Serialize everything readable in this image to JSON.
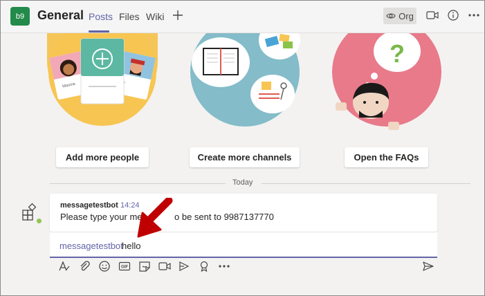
{
  "header": {
    "team_initials": "b9",
    "channel_title": "General",
    "tabs": [
      {
        "label": "Posts",
        "active": true
      },
      {
        "label": "Files",
        "active": false
      },
      {
        "label": "Wiki",
        "active": false
      }
    ],
    "add_tab_label": "+",
    "org_label": "Org",
    "icons": [
      "eye-icon",
      "meet-now-icon",
      "info-icon",
      "more-options-icon"
    ]
  },
  "welcome": {
    "buttons": [
      {
        "label": "Add more people"
      },
      {
        "label": "Create more channels"
      },
      {
        "label": "Open the FAQs"
      }
    ],
    "illustration_names": [
      "Maxine",
      "ay"
    ]
  },
  "divider": {
    "label": "Today"
  },
  "message": {
    "sender": "messagetestbot",
    "time": "14:24",
    "text": "Please type your message to be sent to 9987137770",
    "text_visible_left": "Please type your mes",
    "text_visible_right": "o be sent to 9987137770"
  },
  "compose": {
    "mention": "messagetestbot",
    "text": "hello"
  },
  "toolbar": {
    "icons": [
      "format-icon",
      "attach-icon",
      "emoji-icon",
      "gif-icon",
      "sticker-icon",
      "meet-icon",
      "stream-icon",
      "praise-icon",
      "more-icon"
    ],
    "gif_label": "GIF",
    "send_icon": "send-icon"
  },
  "colors": {
    "brand": "#6264a7",
    "team_avatar": "#228a4a",
    "annotation_arrow": "#c00000",
    "presence": "#92c353"
  }
}
